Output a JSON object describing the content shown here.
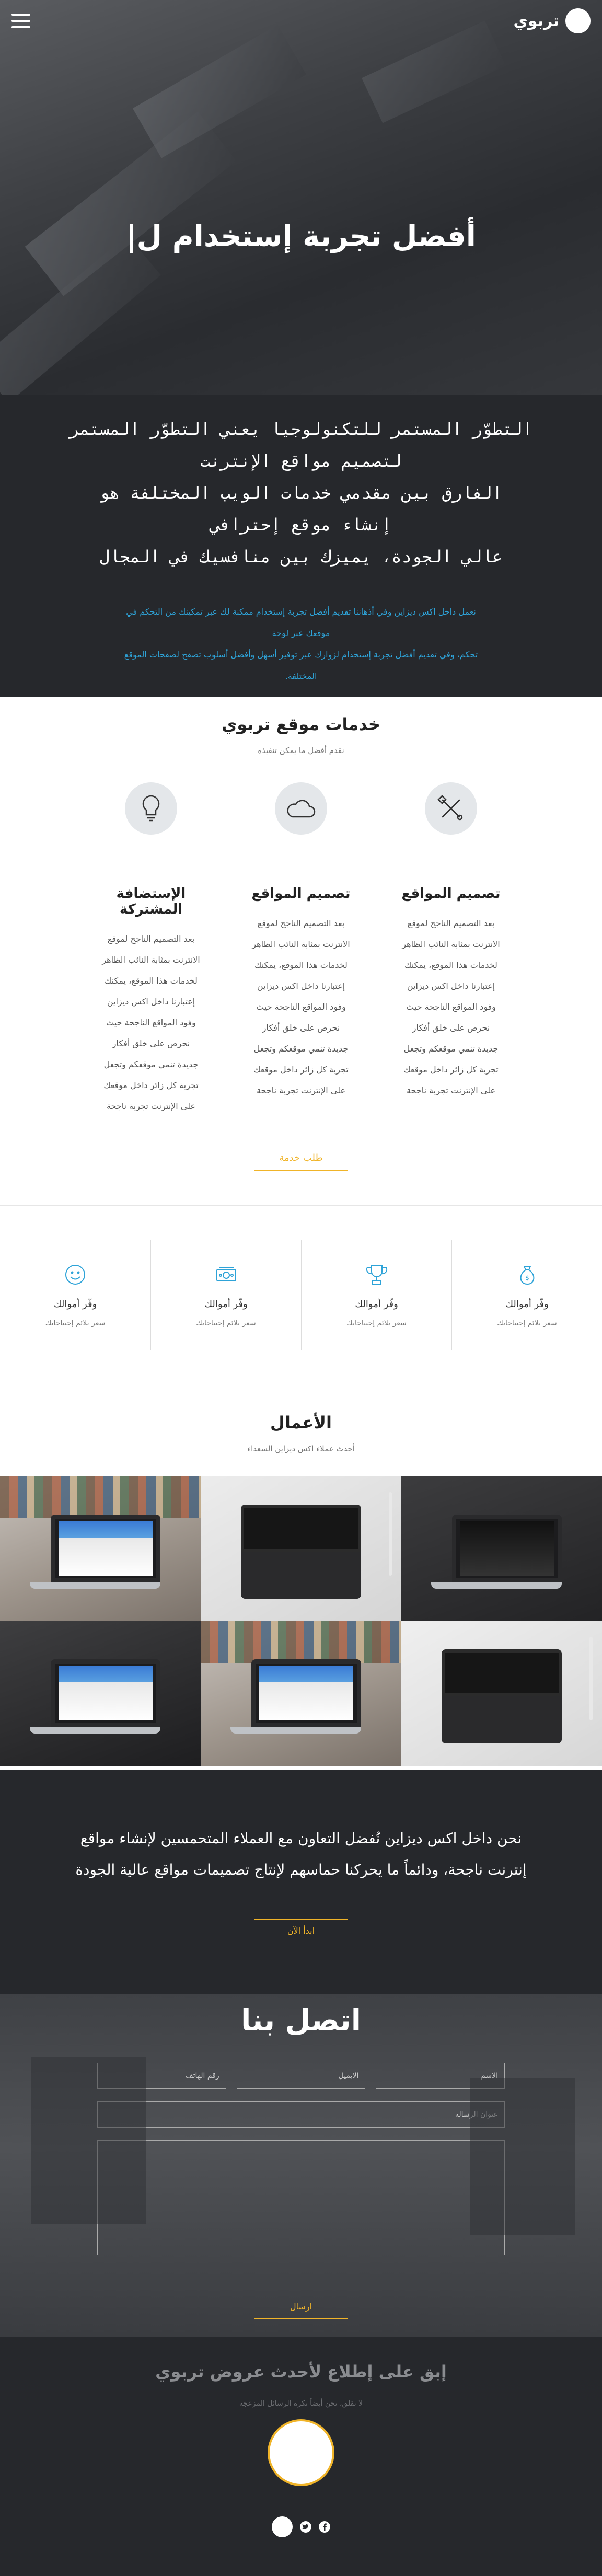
{
  "header": {
    "logo_text": "تربوي"
  },
  "hero": {
    "title": "أفضل تجربة إستخدام ل|"
  },
  "intro": {
    "lines": [
      "التطوّر المستمر للتكنولوجيا يعني التطوّر المستمر",
      "لتصميم مواقع الإنترنت",
      "الفارق بين مقدمي خدمات الويب المختلفة هو",
      "إنشاء موقع إحترافي",
      "عالي الجودة، يميزك بين منافسيك في المجال"
    ],
    "sub_lines": [
      "نعمل داخل اكس ديزاين وفي أذهاننا تقديم أفضل تجربة إستخدام ممكنة لك عبر تمكينك من التحكم في",
      "موقعك عبر لوحة",
      "تحكم، وفي تقديم أفضل تجربة إستخدام لزوارك عبر توفير أسهل وأفضل أسلوب تصفح لصفحات الموقع",
      "المختلفة."
    ]
  },
  "services": {
    "title": "خدمات موقع تربوي",
    "subtitle": "نقدم أفضل ما يمكن تنفيذه",
    "items": [
      {
        "title": "تصميم المواقع",
        "icon": "tools-icon",
        "body": [
          "بعد التصميم الناجح لموقع",
          "الانترنت بمثابة النائب الظاهر",
          "لخدمات هذا الموقع، يمكنك",
          "إعتبارنا داخل اكس ديزاين",
          "وفود المواقع الناجحة حيث",
          "نحرص على خلق أفكار",
          "جديدة تنمي موقعكم وتجعل",
          "تجربة كل زائر داخل موقعك",
          "على الإنترنت تجربة ناجحة"
        ]
      },
      {
        "title": "تصميم المواقع",
        "icon": "cloud-icon",
        "body": [
          "بعد التصميم الناجح لموقع",
          "الانترنت بمثابة النائب الظاهر",
          "لخدمات هذا الموقع، يمكنك",
          "إعتبارنا داخل اكس ديزاين",
          "وفود المواقع الناجحة حيث",
          "نحرص على خلق أفكار",
          "جديدة تنمي موقعكم وتجعل",
          "تجربة كل زائر داخل موقعك",
          "على الإنترنت تجربة ناجحة"
        ]
      },
      {
        "title": "الإستضافة المشتركة",
        "icon": "lightbulb-icon",
        "body": [
          "بعد التصميم الناجح لموقع",
          "الانترنت بمثابة النائب الظاهر",
          "لخدمات هذا الموقع، يمكنك",
          "إعتبارنا داخل اكس ديزاين",
          "وفود المواقع الناجحة حيث",
          "نحرص على خلق أفكار",
          "جديدة تنمي موقعكم وتجعل",
          "تجربة كل زائر داخل موقعك",
          "على الإنترنت تجربة ناجحة"
        ]
      }
    ],
    "button": "طلب خدمة"
  },
  "features": [
    {
      "title": "وفّر أموالك",
      "sub": "سعر يلائم إحتياجاتك",
      "icon": "money-bag-icon"
    },
    {
      "title": "وفّر أموالك",
      "sub": "سعر يلائم إحتياجاتك",
      "icon": "trophy-icon"
    },
    {
      "title": "وفّر أموالك",
      "sub": "سعر يلائم إحتياجاتك",
      "icon": "cash-icon"
    },
    {
      "title": "وفّر أموالك",
      "sub": "سعر يلائم إحتياجاتك",
      "icon": "smiley-icon"
    }
  ],
  "works": {
    "title": "الأعمال",
    "subtitle": "أحدث عملاء اكس ديزاين السعداء"
  },
  "cta": {
    "lines": [
      "نحن داخل اكس ديزاين نُفضل التعاون مع العملاء المتحمسين لإنشاء مواقع",
      "إنترنت ناجحة، ودائماً ما يحركنا حماسهم لإنتاج تصميمات مواقع عالية الجودة"
    ],
    "button": "ابدأ الآن"
  },
  "contact": {
    "title": "اتصل بنا",
    "name_placeholder": "الاسم",
    "email_placeholder": "الايميل",
    "phone_placeholder": "رقم الهاتف",
    "subject_placeholder": "عنوان الرسالة",
    "button": "ارسال"
  },
  "footer": {
    "title": "إبق على إطلاع لأحدث عروض تربوي",
    "subtitle": "لا تقلق، نحن أيضاً نكره الرسائل المزعجة"
  },
  "colors": {
    "accent": "#f0b429",
    "dark": "#26282c",
    "link": "#2ea3d8"
  }
}
